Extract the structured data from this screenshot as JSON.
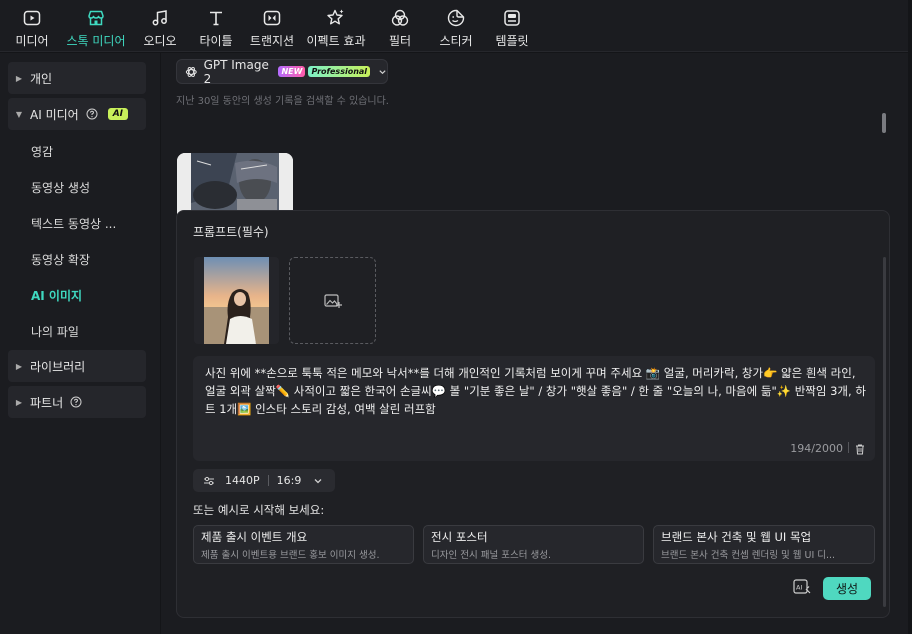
{
  "toolbar": {
    "items": [
      {
        "label": "미디어",
        "icon": "media-play-icon"
      },
      {
        "label": "스톡 미디어",
        "icon": "store-icon"
      },
      {
        "label": "오디오",
        "icon": "music-note-icon"
      },
      {
        "label": "타이틀",
        "icon": "text-t-icon"
      },
      {
        "label": "트랜지션",
        "icon": "transition-icon"
      },
      {
        "label": "이펙트 효과",
        "icon": "effect-sparkle-icon"
      },
      {
        "label": "필터",
        "icon": "filter-icon"
      },
      {
        "label": "스티커",
        "icon": "sticker-icon"
      },
      {
        "label": "템플릿",
        "icon": "template-icon"
      }
    ],
    "active_color": "#3fd9c0"
  },
  "sidebar": {
    "groups": {
      "personal": "개인",
      "ai_media": "AI 미디어",
      "ai_badge": "AI",
      "library": "라이브러리",
      "partner": "파트너"
    },
    "items": [
      "영감",
      "동영상 생성",
      "텍스트 동영상 ...",
      "동영상 확장",
      "AI 이미지",
      "나의 파일"
    ],
    "active_item": "AI 이미지"
  },
  "model": {
    "name": "GPT Image 2",
    "badge_new": "NEW",
    "badge_pro": "Professional"
  },
  "history_hint": "지난 30일 동안의 생성 기록을 검색할 수 있습니다.",
  "panel": {
    "title": "프롬프트(필수)",
    "prompt": "사진 위에 **손으로 툭툭 적은 메모와 낙서**를 더해 개인적인 기록처럼 보이게 꾸며 주세요 📸 얼굴, 머리카락, 창가👉 얇은 흰색 라인, 얼굴 외곽 살짝✏️ 사적이고 짧은 한국어 손글씨💬 볼 \"기분 좋은 날\" / 창가 \"햇살 좋음\" / 한 줄 \"오늘의 나, 마음에 듦\"✨ 반짝임 3개, 하트 1개🖼️ 인스타 스토리 감성, 여백 살린 러프함",
    "counter": "194/2000",
    "resolution": "1440P",
    "aspect": "16:9",
    "examples_title": "또는 예시로 시작해 보세요:",
    "examples": [
      {
        "title": "제품 출시 이벤트 개요",
        "desc": "제품 출시 이벤트용 브랜드 홍보 이미지 생성."
      },
      {
        "title": "전시 포스터",
        "desc": "디자인 전시 패널 포스터 생성."
      },
      {
        "title": "브랜드 본사 건축 및 웹 UI 목업",
        "desc": "브랜드 본사 건축 컨셉 렌더링 및 웹 UI 디..."
      }
    ],
    "generate_label": "생성"
  }
}
